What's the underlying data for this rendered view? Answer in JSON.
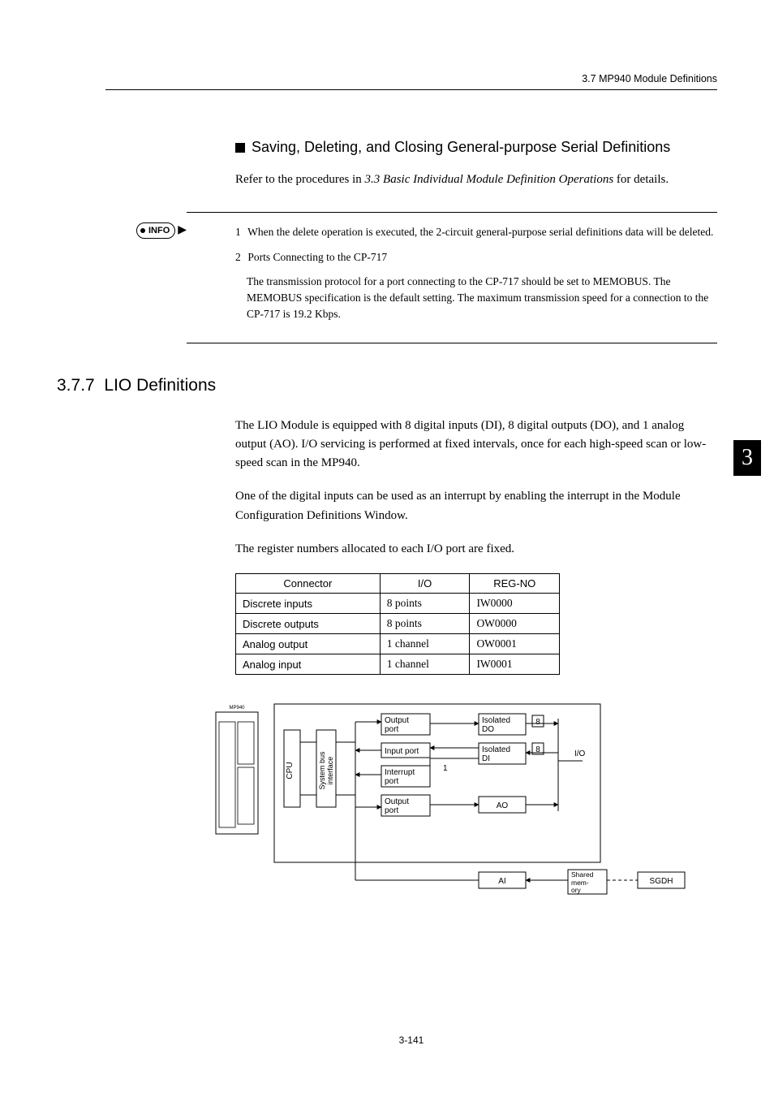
{
  "header": {
    "running": "3.7  MP940 Module Definitions"
  },
  "subsection": {
    "title": "Saving, Deleting, and Closing General-purpose Serial Definitions",
    "para_pre": "Refer to the procedures in ",
    "para_ref": "3.3 Basic Individual Module Definition Operations",
    "para_post": " for details."
  },
  "info": {
    "badge": "INFO",
    "item1_num": "1",
    "item1": "When the delete operation is executed, the 2-circuit general-purpose serial definitions data will be deleted.",
    "item2_num": "2",
    "item2": "Ports Connecting to the CP-717",
    "item2_sub": "The transmission protocol for a port connecting to the CP-717 should be set to MEMOBUS. The MEMOBUS specification is the default setting. The maximum transmission speed for a connection to the CP-717 is 19.2 Kbps."
  },
  "section": {
    "number": "3.7.7",
    "title": "LIO Definitions",
    "p1": "The LIO Module is equipped with 8 digital inputs (DI), 8 digital outputs (DO), and 1 analog output (AO). I/O servicing is performed at fixed intervals, once for each high-speed scan or low-speed scan in the MP940.",
    "p2": "One of the digital inputs can be used as an interrupt by enabling the interrupt in the Module Configuration Definitions Window.",
    "p3": "The register numbers allocated to each I/O port are fixed."
  },
  "ioTable": {
    "h1": "Connector",
    "h2": "I/O",
    "h3": "REG-NO",
    "rows": [
      {
        "c": "Discrete inputs",
        "io": "8 points",
        "reg": "IW0000"
      },
      {
        "c": "Discrete outputs",
        "io": "8 points",
        "reg": "OW0000"
      },
      {
        "c": "Analog output",
        "io": "1 channel",
        "reg": "OW0001"
      },
      {
        "c": "Analog input",
        "io": "1 channel",
        "reg": "IW0001"
      }
    ]
  },
  "diagram": {
    "module_label": "MP940",
    "cpu": "CPU",
    "sysbus": "System bus interface",
    "out1": "Output port",
    "in1": "Input port",
    "intr": "Interrupt port",
    "out2": "Output port",
    "iso_do": "Isolated DO",
    "iso_di": "Isolated DI",
    "ao": "AO",
    "ai": "AI",
    "io": "I/O",
    "shared": "Shared memory",
    "sgdh": "SGDH",
    "n8a": "8",
    "n8b": "8",
    "n1": "1"
  },
  "chapterTab": "3",
  "footer": "3-141"
}
